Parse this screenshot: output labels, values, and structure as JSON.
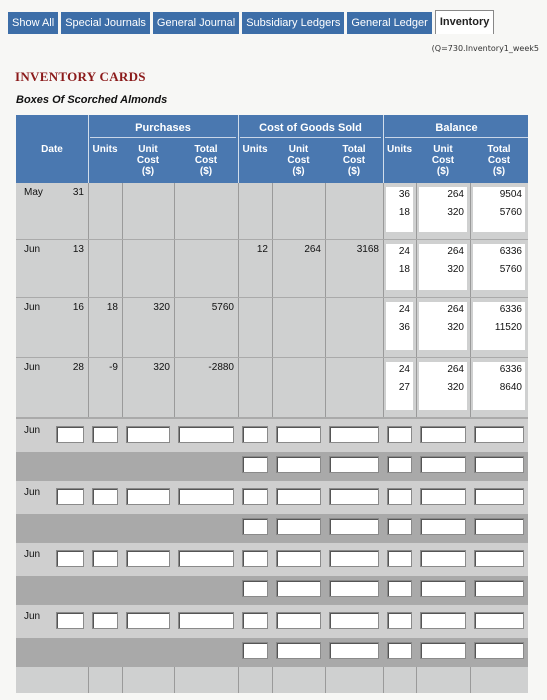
{
  "tabs": [
    "Show All",
    "Special Journals",
    "General Journal",
    "Subsidiary Ledgers",
    "General Ledger",
    "Inventory"
  ],
  "active_tab": "Inventory",
  "question_ref": "(Q=730.Inventory1_week5",
  "page_title": "INVENTORY CARDS",
  "card_subtitle": "Boxes Of Scorched Almonds",
  "header": {
    "date": "Date",
    "purchases": "Purchases",
    "cogs": "Cost of Goods Sold",
    "balance": "Balance",
    "units": "Units",
    "unit_cost": [
      "Unit",
      "Cost",
      "($)"
    ],
    "total_cost": [
      "Total",
      "Cost",
      "($)"
    ]
  },
  "rows": [
    {
      "month": "May",
      "day": "31",
      "p_units": "",
      "p_unit_cost": "",
      "p_total": "",
      "c_units": "",
      "c_unit_cost": "",
      "c_total": "",
      "b_units": [
        "36",
        "18"
      ],
      "b_unit_cost": [
        "264",
        "320"
      ],
      "b_total": [
        "9504",
        "5760"
      ]
    },
    {
      "month": "Jun",
      "day": "13",
      "p_units": "",
      "p_unit_cost": "",
      "p_total": "",
      "c_units": "12",
      "c_unit_cost": "264",
      "c_total": "3168",
      "b_units": [
        "24",
        "18"
      ],
      "b_unit_cost": [
        "264",
        "320"
      ],
      "b_total": [
        "6336",
        "5760"
      ]
    },
    {
      "month": "Jun",
      "day": "16",
      "p_units": "18",
      "p_unit_cost": "320",
      "p_total": "5760",
      "c_units": "",
      "c_unit_cost": "",
      "c_total": "",
      "b_units": [
        "24",
        "36"
      ],
      "b_unit_cost": [
        "264",
        "320"
      ],
      "b_total": [
        "6336",
        "11520"
      ]
    },
    {
      "month": "Jun",
      "day": "28",
      "p_units": "-9",
      "p_unit_cost": "320",
      "p_total": "-2880",
      "c_units": "",
      "c_unit_cost": "",
      "c_total": "",
      "b_units": [
        "24",
        "27"
      ],
      "b_unit_cost": [
        "264",
        "320"
      ],
      "b_total": [
        "6336",
        "8640"
      ]
    }
  ],
  "input_rows": [
    {
      "month": "Jun"
    },
    {
      "month": "Jun"
    },
    {
      "month": "Jun"
    },
    {
      "month": "Jun"
    }
  ],
  "colors": {
    "tab_blue": "#3d6ea8",
    "header_blue": "#4a78b0",
    "title_red": "#8b1a1a"
  }
}
